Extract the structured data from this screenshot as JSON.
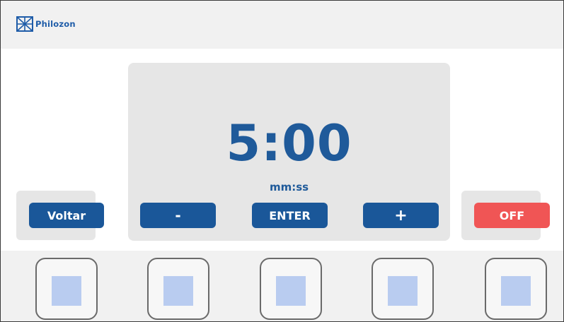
{
  "header": {
    "brand": "Philozon",
    "logo_icon": "philozon-logo-icon",
    "brand_color": "#1e5ca8"
  },
  "display": {
    "time": "5:00",
    "unit": "mm:ss"
  },
  "buttons": {
    "voltar": "Voltar",
    "minus": "-",
    "enter": "ENTER",
    "plus": "+",
    "off": "OFF"
  },
  "colors": {
    "button_blue": "#1a5799",
    "off_red": "#f05555",
    "display_text": "#1f5a9a",
    "key_fill": "#b9ccf0"
  }
}
